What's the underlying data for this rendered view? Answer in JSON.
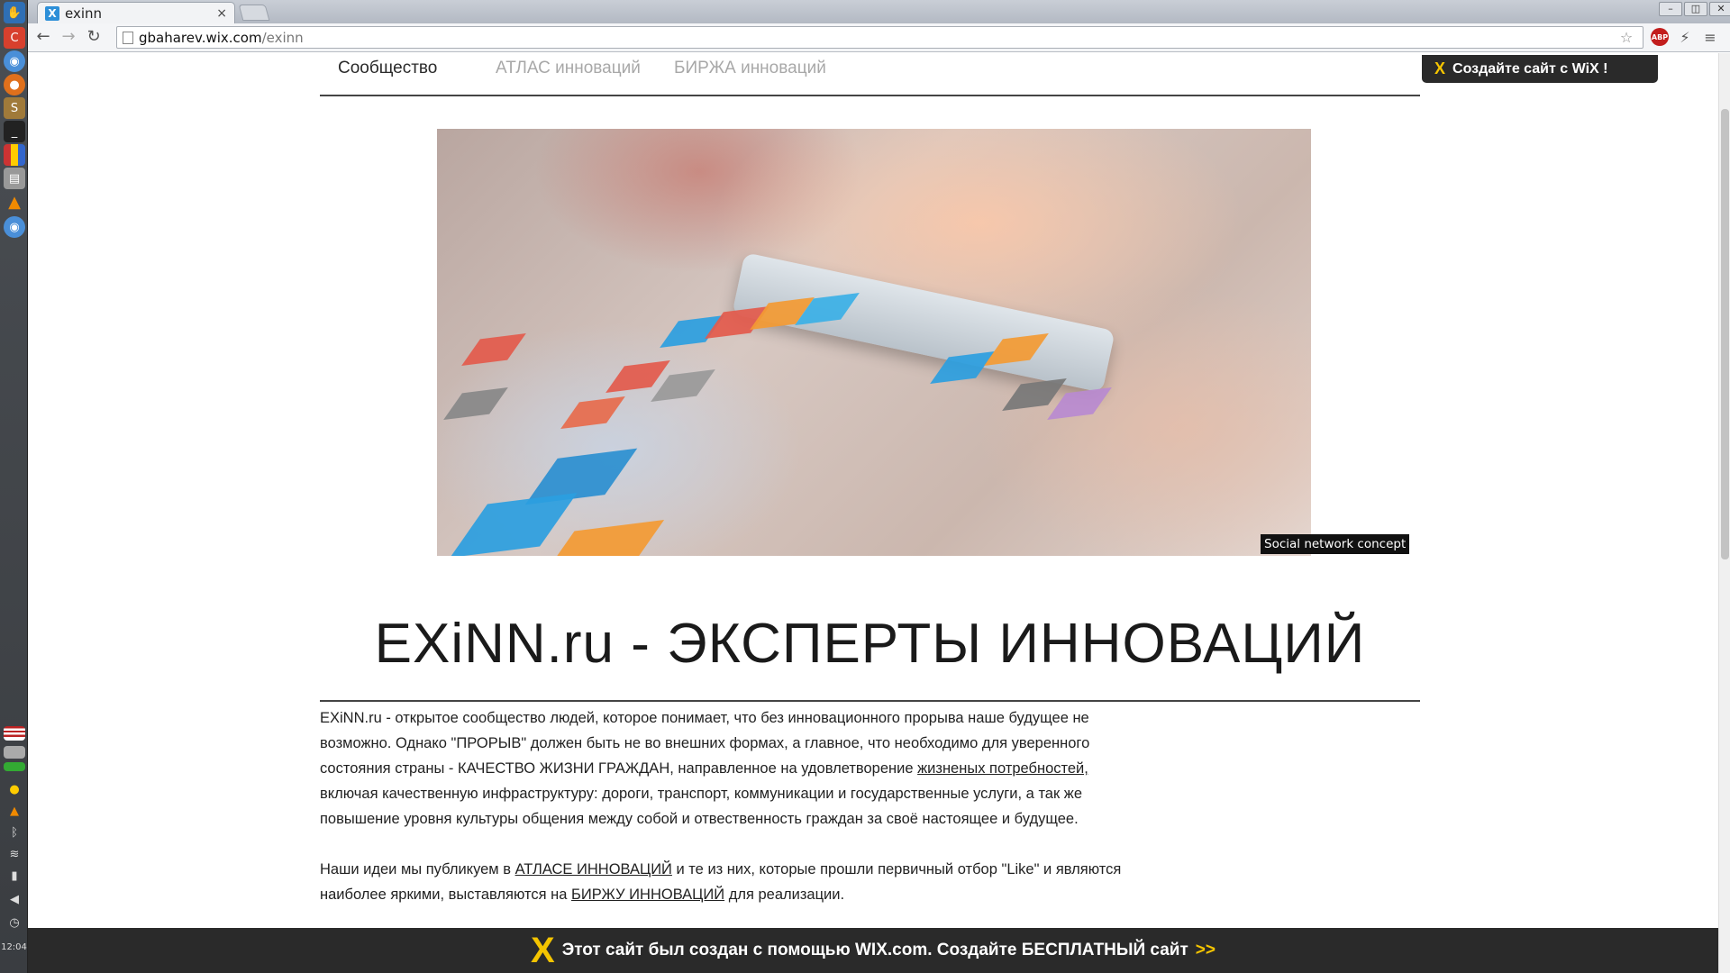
{
  "browser": {
    "tab_title": "exinn",
    "tab_close": "×",
    "url_domain": "gbaharev.wix.com",
    "url_path": "/exinn",
    "abp_label": "ABP"
  },
  "os": {
    "clock": "12:04"
  },
  "site": {
    "nav": [
      {
        "label": "Сообщество"
      },
      {
        "label": "АТЛАС инноваций"
      },
      {
        "label": "БИРЖА инноваций"
      }
    ],
    "wix_create": {
      "icon": "X",
      "label": "Создайте сайт с WiX !"
    },
    "hero_caption": "Social network concept",
    "headline": "EXiNN.ru - ЭКСПЕРТЫ ИННОВАЦИЙ",
    "paragraph1": {
      "part1": "EXiNN.ru - открытое сообщество людей, которое понимает, что без инновационного прорыва наше будущее не возможно. Однако \"ПРОРЫВ\" должен быть не во внешних формах, а главное, что необходимо для уверенного состояния страны - КАЧЕСТВО ЖИЗНИ ГРАЖДАН, направленное на удовлетворение ",
      "link": "жизненых потребностей,",
      "part2": " включая качественную инфраструктуру: дороги, транспорт, коммуникации и государственные услуги, а так же повышение уровня культуры общения между собой и отвественность граждан за своё настоящее и будущее."
    },
    "paragraph2": {
      "part1": "Наши идеи мы публикуем в ",
      "link1": "АТЛАСЕ ИННОВАЦИЙ",
      "part2": " и те из них, которые прошли первичный отбор \"Like\" и являются наиболее яркими,  выставляются на ",
      "link2": "БИРЖУ ИННОВАЦИЙ",
      "part3": " для реализации."
    },
    "banner": {
      "logo": "X",
      "text": "Этот сайт был создан с помощью WIX.com. Создайте БЕСПЛАТНЫЙ сайт",
      "arrows": ">>"
    }
  },
  "colors": {
    "wix_yellow": "#f4c400",
    "banner_bg": "#2a2a2a",
    "nav_muted": "#a8a8a8"
  }
}
